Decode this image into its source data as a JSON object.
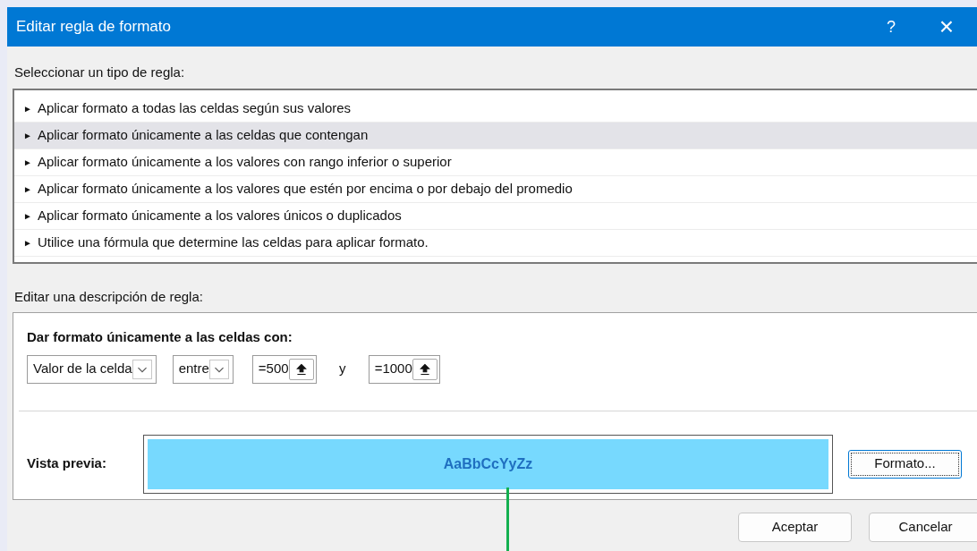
{
  "window": {
    "title": "Editar regla de formato",
    "help": "?",
    "close": "×"
  },
  "rule_types": {
    "label": "Seleccionar un tipo de regla:",
    "items": [
      {
        "marker": "►",
        "label": "Aplicar formato a todas las celdas según sus valores",
        "selected": false
      },
      {
        "marker": "►",
        "label": "Aplicar formato únicamente a las celdas que contengan",
        "selected": true
      },
      {
        "marker": "►",
        "label": "Aplicar formato únicamente a los valores con rango inferior o superior",
        "selected": false
      },
      {
        "marker": "►",
        "label": "Aplicar formato únicamente a los valores que estén por encima o por debajo del promedio",
        "selected": false
      },
      {
        "marker": "►",
        "label": "Aplicar formato únicamente a los valores únicos o duplicados",
        "selected": false
      },
      {
        "marker": "►",
        "label": "Utilice una fórmula que determine las celdas para aplicar formato.",
        "selected": false
      }
    ]
  },
  "description": {
    "label": "Editar una descripción de regla:",
    "heading": "Dar formato únicamente a las celdas con:",
    "condition": {
      "kind_dropdown": "Valor de la celda",
      "operator_dropdown": "entre",
      "value_1": "=500",
      "joiner": "y",
      "value_2": "=1000"
    },
    "preview": {
      "label": "Vista previa:",
      "sample": "AaBbCcYyZz"
    },
    "format_button": "Formato..."
  },
  "buttons": [
    "Aceptar",
    "Cancelar"
  ]
}
